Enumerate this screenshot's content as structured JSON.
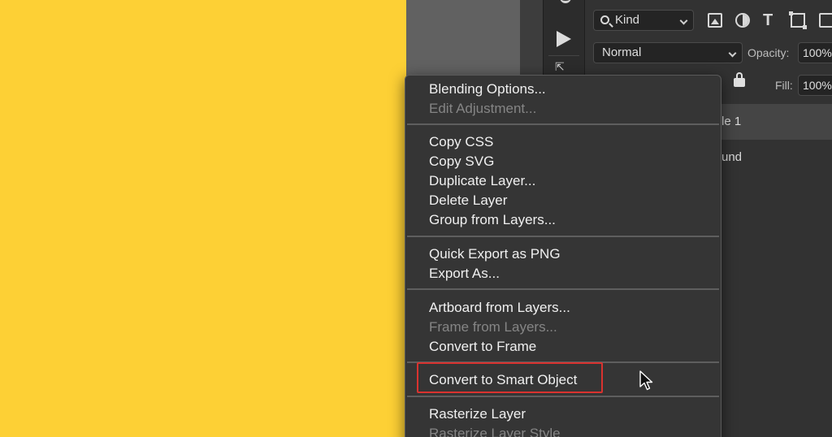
{
  "layers_panel": {
    "filter_kind": "Kind",
    "blend_mode": "Normal",
    "opacity_label": "Opacity:",
    "opacity_value": "100%",
    "fill_label": "Fill:",
    "fill_value": "100%",
    "layers": [
      {
        "name": "le 1"
      },
      {
        "name": "und"
      }
    ]
  },
  "context_menu": {
    "items": [
      {
        "label": "Blending Options...",
        "enabled": true
      },
      {
        "label": "Edit Adjustment...",
        "enabled": false
      },
      {
        "label": "Copy CSS",
        "enabled": true
      },
      {
        "label": "Copy SVG",
        "enabled": true
      },
      {
        "label": "Duplicate Layer...",
        "enabled": true
      },
      {
        "label": "Delete Layer",
        "enabled": true
      },
      {
        "label": "Group from Layers...",
        "enabled": true
      },
      {
        "label": "Quick Export as PNG",
        "enabled": true
      },
      {
        "label": "Export As...",
        "enabled": true
      },
      {
        "label": "Artboard from Layers...",
        "enabled": true
      },
      {
        "label": "Frame from Layers...",
        "enabled": false
      },
      {
        "label": "Convert to Frame",
        "enabled": true
      },
      {
        "label": "Convert to Smart Object",
        "enabled": true,
        "highlighted": true
      },
      {
        "label": "Rasterize Layer",
        "enabled": true
      },
      {
        "label": "Rasterize Layer Style",
        "enabled": false
      }
    ]
  },
  "colors": {
    "canvas": "#fdd035",
    "menu_background": "#353535",
    "highlight_outline": "#d9322f"
  }
}
